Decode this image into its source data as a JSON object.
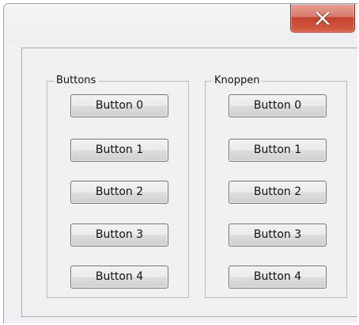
{
  "window": {
    "close_glyph": "X",
    "close_icon": "close-icon"
  },
  "groups": [
    {
      "label": "Buttons",
      "buttons": [
        "Button 0",
        "Button 1",
        "Button 2",
        "Button 3",
        "Button 4"
      ]
    },
    {
      "label": "Knoppen",
      "buttons": [
        "Button 0",
        "Button 1",
        "Button 2",
        "Button 3",
        "Button 4"
      ]
    }
  ],
  "colors": {
    "close_button": "#c7412c",
    "window_background": "#f0f0f0"
  }
}
